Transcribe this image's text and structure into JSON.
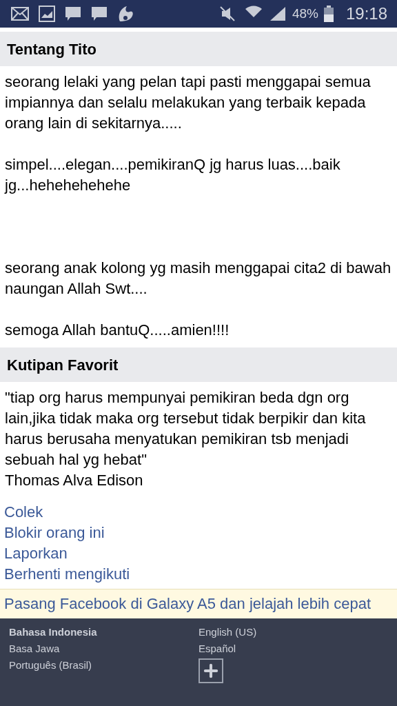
{
  "status_bar": {
    "battery": "48%",
    "time": "19:18"
  },
  "sections": [
    {
      "title": "Tentang Tito",
      "text": "seorang lelaki yang pelan tapi pasti menggapai semua impiannya dan selalu melakukan yang terbaik kepada orang lain di sekitarnya.....\n\nsimpel....elegan....pemikiranQ jg harus luas....baik jg...hehehehehehe\n\n\n\nseorang anak kolong yg masih menggapai cita2 di bawah naungan Allah Swt....\n\nsemoga Allah bantuQ.....amien!!!!"
    },
    {
      "title": "Kutipan Favorit",
      "text": "\"tiap org harus mempunyai pemikiran beda dgn org lain,jika tidak maka org tersebut tidak berpikir dan kita harus berusaha menyatukan pemikiran tsb menjadi sebuah hal yg hebat\"\nThomas Alva Edison"
    }
  ],
  "actions": [
    "Colek",
    "Blokir orang ini",
    "Laporkan",
    "Berhenti mengikuti"
  ],
  "install_banner": "Pasang Facebook di Galaxy A5 dan jelajah lebih cepat",
  "languages": [
    {
      "label": "Bahasa Indonesia",
      "selected": true
    },
    {
      "label": "English (US)",
      "selected": false
    },
    {
      "label": "Basa Jawa",
      "selected": false
    },
    {
      "label": "Español",
      "selected": false
    },
    {
      "label": "Português (Brasil)",
      "selected": false
    }
  ]
}
